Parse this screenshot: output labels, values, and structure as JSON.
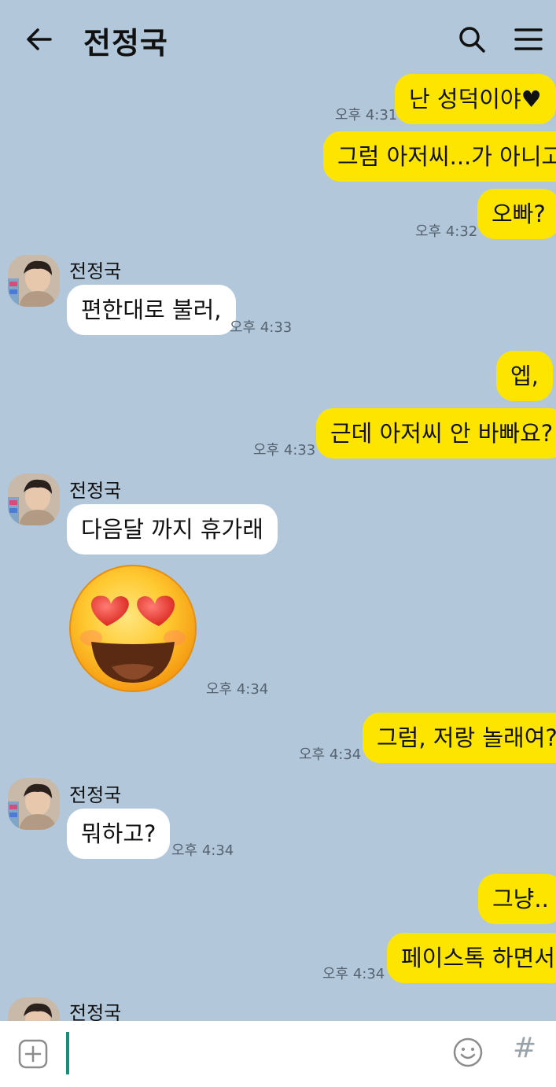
{
  "header": {
    "title": "전정국",
    "back_icon": "arrow-left-icon",
    "search_icon": "search-icon",
    "menu_icon": "hamburger-menu-icon"
  },
  "contact": {
    "name": "전정국"
  },
  "messages": [
    {
      "side": "me",
      "text": "난 성덕이야♥",
      "time": "오후 4:31"
    },
    {
      "side": "me",
      "text": "그럼 아저씨...가 아니고",
      "time": ""
    },
    {
      "side": "me",
      "text": "오빠?",
      "time": "오후 4:32"
    },
    {
      "side": "them",
      "text": "편한대로 불러,",
      "time": "오후 4:33"
    },
    {
      "side": "me",
      "text": "엡,",
      "time": ""
    },
    {
      "side": "me",
      "text": "근데 아저씨 안 바빠요?",
      "time": "오후 4:33"
    },
    {
      "side": "them",
      "text": "다음달 까지 휴가래",
      "time": ""
    },
    {
      "side": "them",
      "emoticon": "heart-eyes-emoji",
      "time": "오후 4:34"
    },
    {
      "side": "me",
      "text": "그럼, 저랑 놀래여?",
      "time": "오후 4:34"
    },
    {
      "side": "them",
      "text": "뭐하고?",
      "time": "오후 4:34"
    },
    {
      "side": "me",
      "text": "그냥..",
      "time": ""
    },
    {
      "side": "me",
      "text": "페이스톡 하면서",
      "time": "오후 4:34"
    }
  ],
  "input_bar": {
    "plus_icon": "plus-square-icon",
    "emoji_icon": "smiley-icon",
    "hash_label": "#"
  },
  "colors": {
    "background": "#b2c7da",
    "my_bubble": "#fee500",
    "their_bubble": "#ffffff",
    "cursor": "#1a8c7a"
  }
}
